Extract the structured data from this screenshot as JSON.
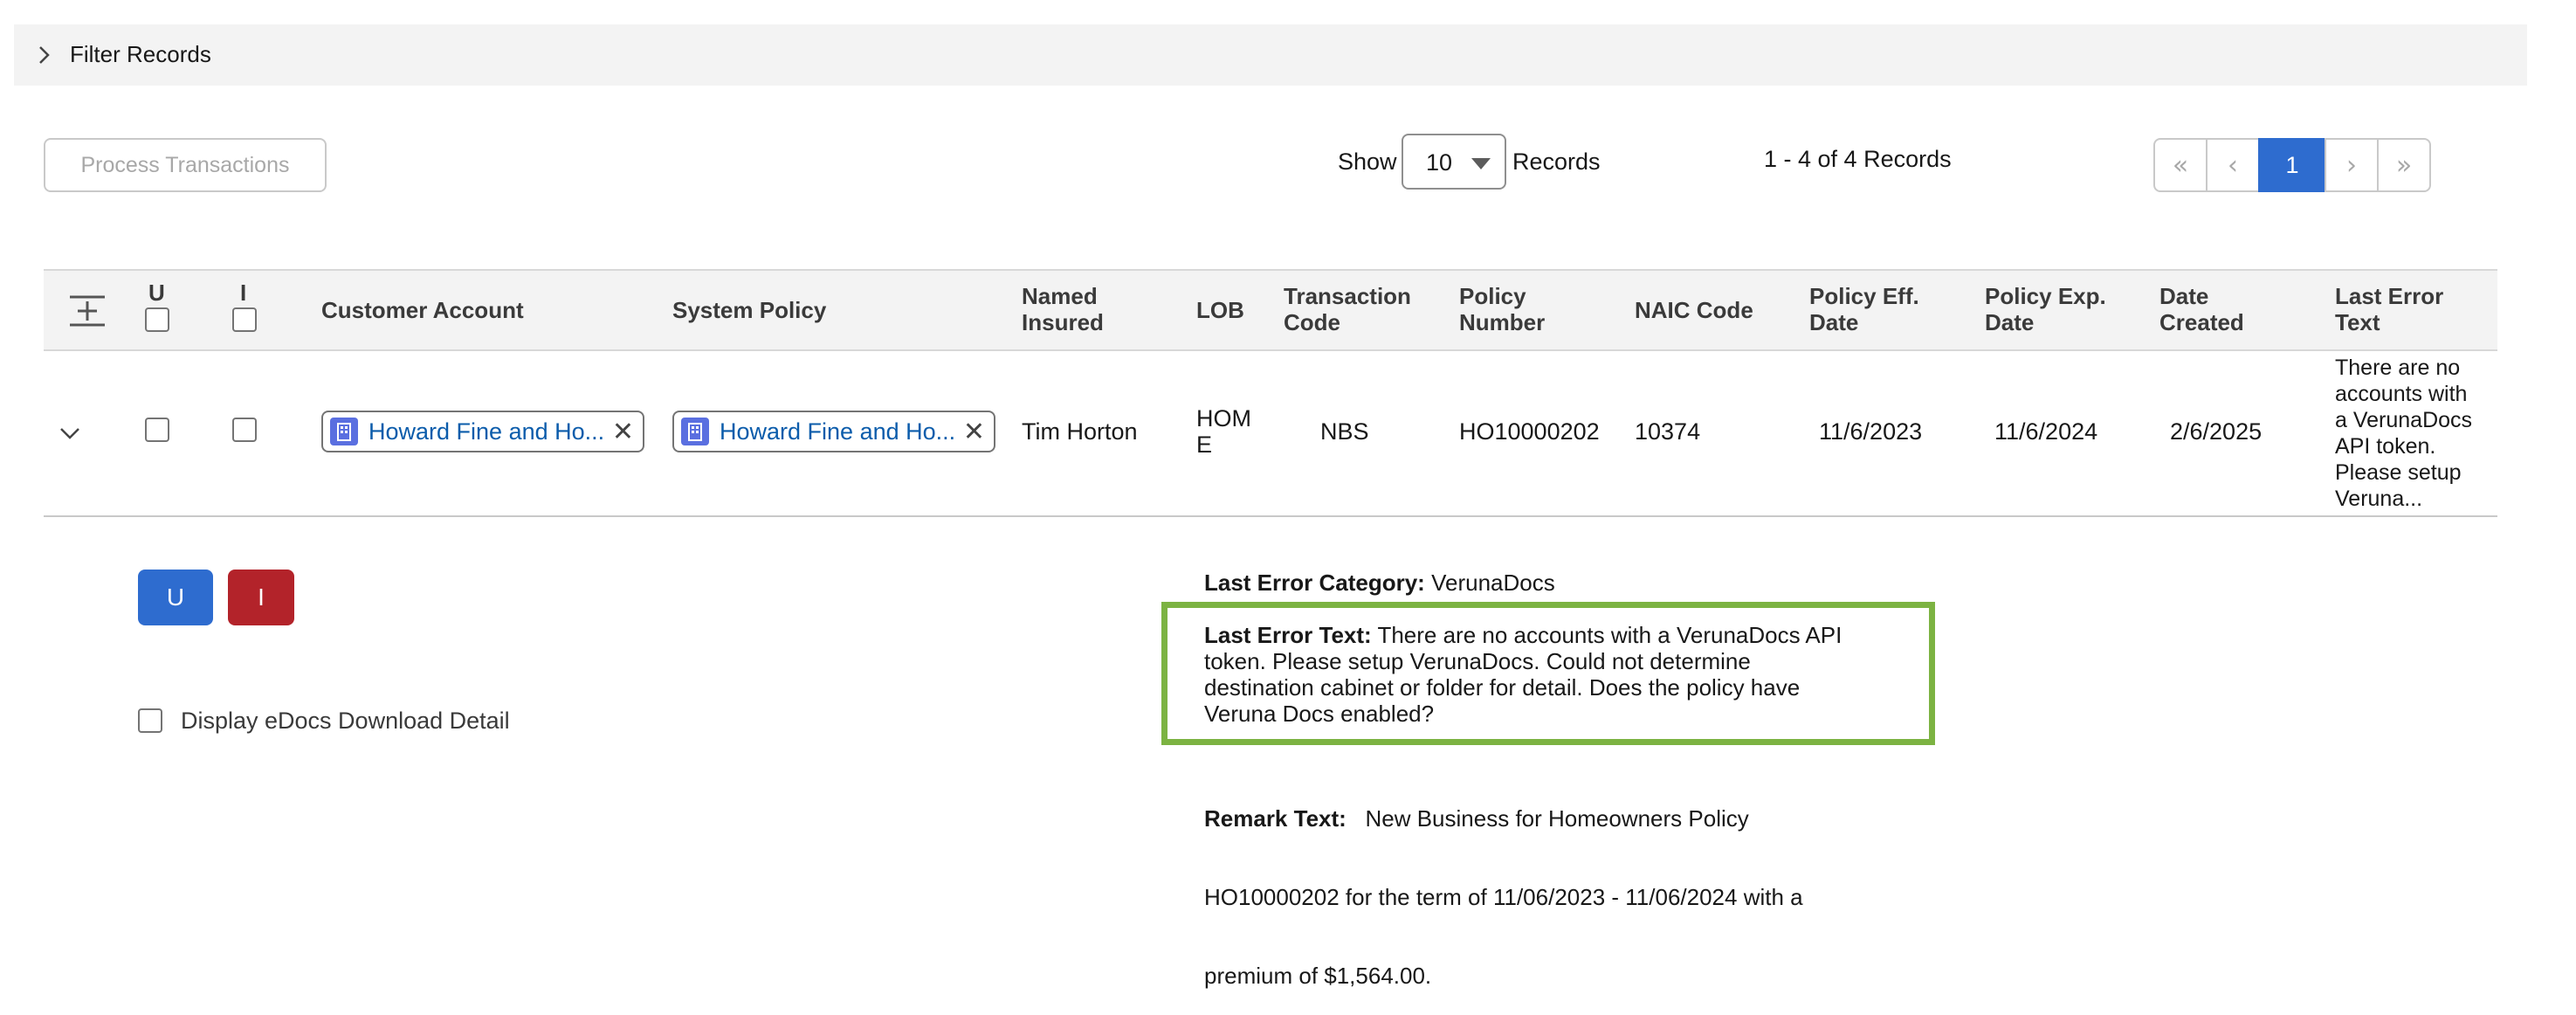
{
  "filter": {
    "label": "Filter Records"
  },
  "toolbar": {
    "process_label": "Process Transactions",
    "show_label": "Show",
    "page_size": "10",
    "records_label": "Records",
    "range": "1 - 4 of 4 Records"
  },
  "pagination": {
    "first": "«",
    "prev": "‹",
    "current": "1",
    "next": "›",
    "last": "»"
  },
  "table": {
    "headers": {
      "u": "U",
      "i": "I",
      "customer_account": "Customer Account",
      "system_policy": "System Policy",
      "named_insured_1": "Named",
      "named_insured_2": "Insured",
      "lob": "LOB",
      "transaction_code_1": "Transaction",
      "transaction_code_2": "Code",
      "policy_number_1": "Policy",
      "policy_number_2": "Number",
      "naic_code": "NAIC Code",
      "policy_eff_1": "Policy Eff.",
      "policy_eff_2": "Date",
      "policy_exp_1": "Policy Exp.",
      "policy_exp_2": "Date",
      "date_created_1": "Date",
      "date_created_2": "Created",
      "last_error_1": "Last Error",
      "last_error_2": "Text"
    },
    "row": {
      "customer_account": "Howard Fine and Ho...",
      "system_policy": "Howard Fine and Ho...",
      "named_insured": "Tim Horton",
      "lob_1": "HOM",
      "lob_2": "E",
      "transaction_code": "NBS",
      "policy_number": "HO10000202",
      "naic_code": "10374",
      "policy_eff": "11/6/2023",
      "policy_exp": "11/6/2024",
      "date_created": "2/6/2025",
      "last_error_lines": [
        "There are no",
        "accounts with",
        "a VerunaDocs",
        "API token.",
        "Please setup",
        "Veruna..."
      ]
    }
  },
  "details": {
    "u_button": "U",
    "i_button": "I",
    "edocs_label": "Display eDocs Download Detail",
    "last_error_category_label": "Last Error Category:",
    "last_error_category_value": "VerunaDocs",
    "last_error_text_label": "Last Error Text:",
    "last_error_text_lines": [
      " There are no accounts with a VerunaDocs API",
      "token. Please setup VerunaDocs. Could not determine",
      "destination cabinet or folder for detail. Does the policy have",
      "Veruna Docs enabled?"
    ],
    "remark_label": "Remark Text:",
    "remark_lines": [
      "   New Business for Homeowners Policy",
      "HO10000202 for the term of 11/06/2023 - 11/06/2024 with a",
      "premium of $1,564.00."
    ]
  },
  "colors": {
    "brand_blue": "#2e6ccf",
    "danger_red": "#b3232a",
    "highlight_green": "#7cb342",
    "link_blue": "#0b5cab"
  }
}
